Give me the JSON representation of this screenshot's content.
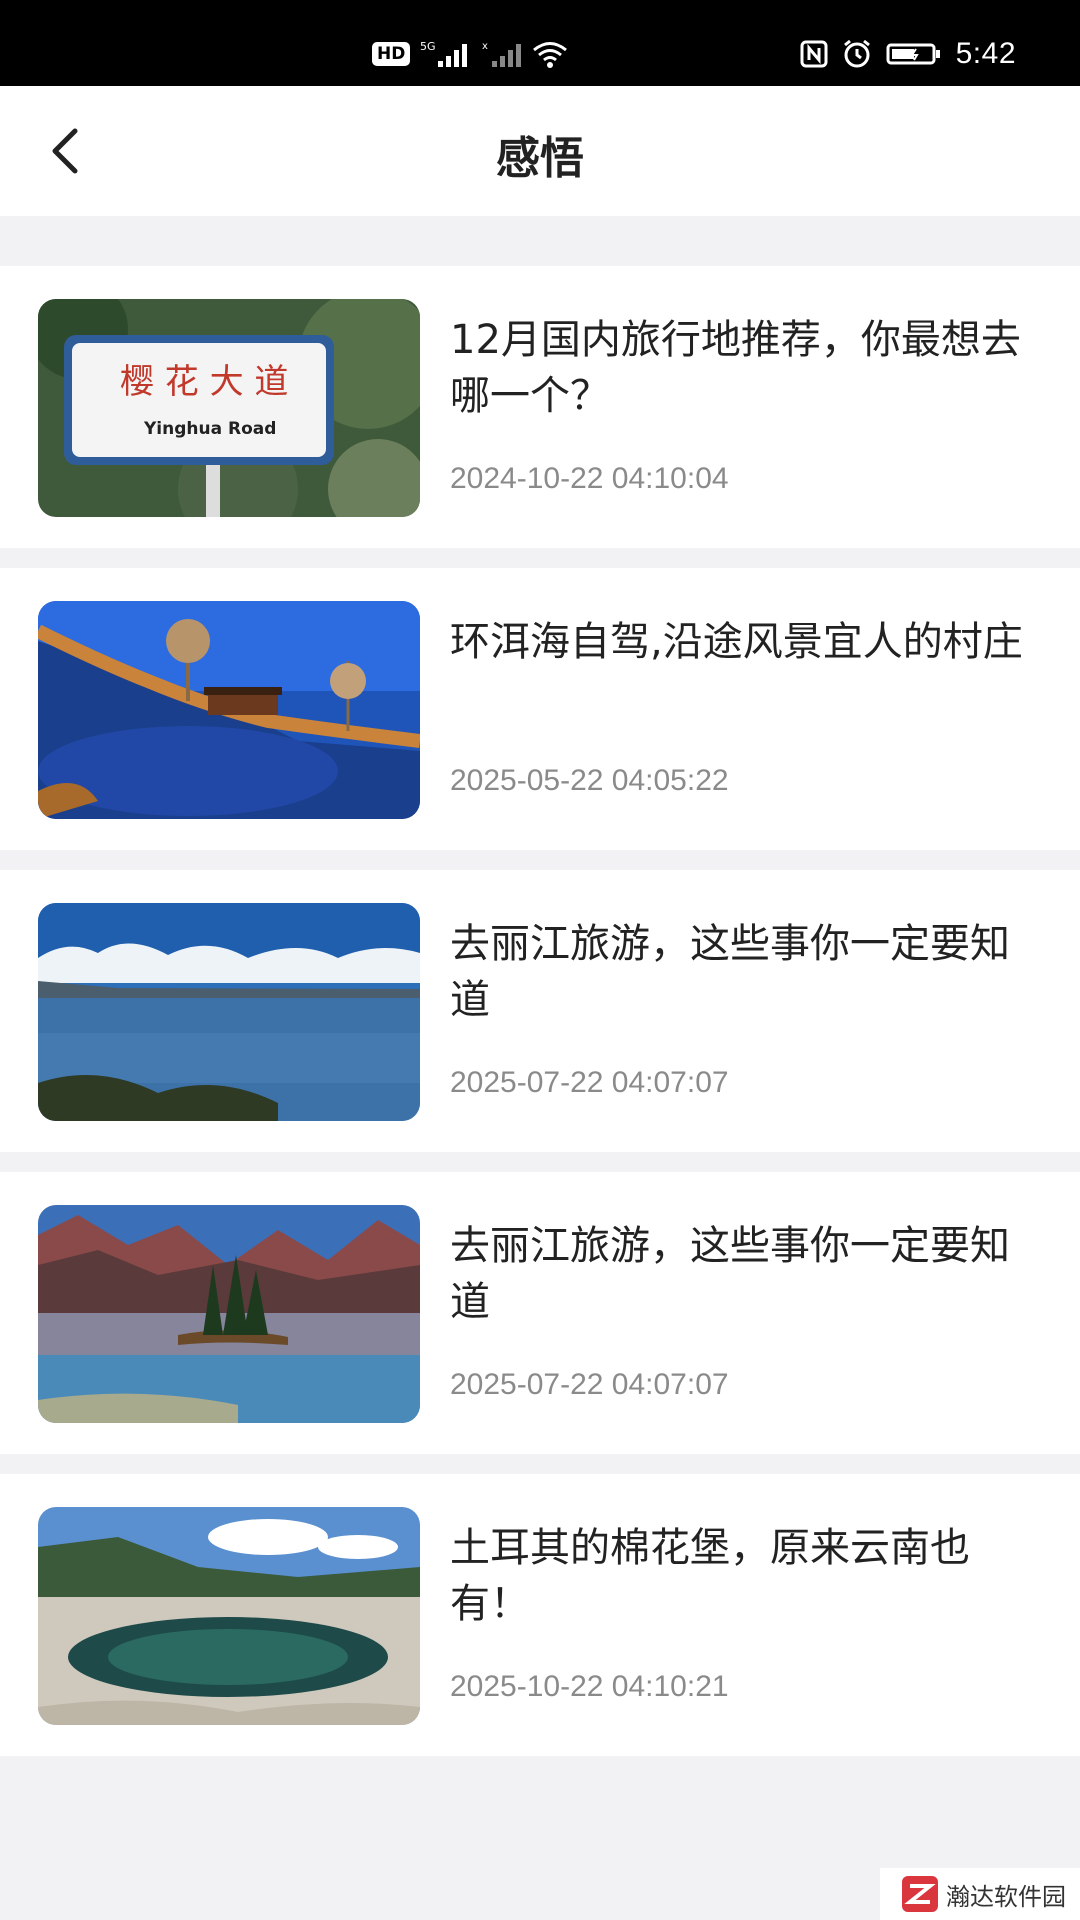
{
  "status_bar": {
    "hd_label": "HD",
    "time": "5:42",
    "icons": [
      "hd-icon",
      "signal-5g-icon",
      "signal-icon",
      "wifi-icon",
      "nfc-icon",
      "alarm-icon",
      "battery-icon"
    ]
  },
  "header": {
    "title": "感悟",
    "back_icon": "chevron-left-icon"
  },
  "articles": [
    {
      "title": "12月国内旅行地推荐，你最想去哪一个？",
      "date": "2024-10-22 04:10:04",
      "image": "cherry-blossom-road-sign"
    },
    {
      "title": "环洱海自驾,沿途风景宜人的村庄",
      "date": "2025-05-22 04:05:22",
      "image": "lakeside-village"
    },
    {
      "title": "去丽江旅游，这些事你一定要知道",
      "date": "2025-07-22 04:07:07",
      "image": "blue-lake-clouds"
    },
    {
      "title": "去丽江旅游，这些事你一定要知道",
      "date": "2025-07-22 04:07:07",
      "image": "mountain-lake-island"
    },
    {
      "title": "土耳其的棉花堡，原来云南也有！",
      "date": "2025-10-22 04:10:21",
      "image": "limestone-pools"
    }
  ],
  "watermark": {
    "text": "瀚达软件园"
  },
  "colors": {
    "background": "#f2f2f4",
    "date_text": "#8a8a8a",
    "title_text": "#222222"
  }
}
